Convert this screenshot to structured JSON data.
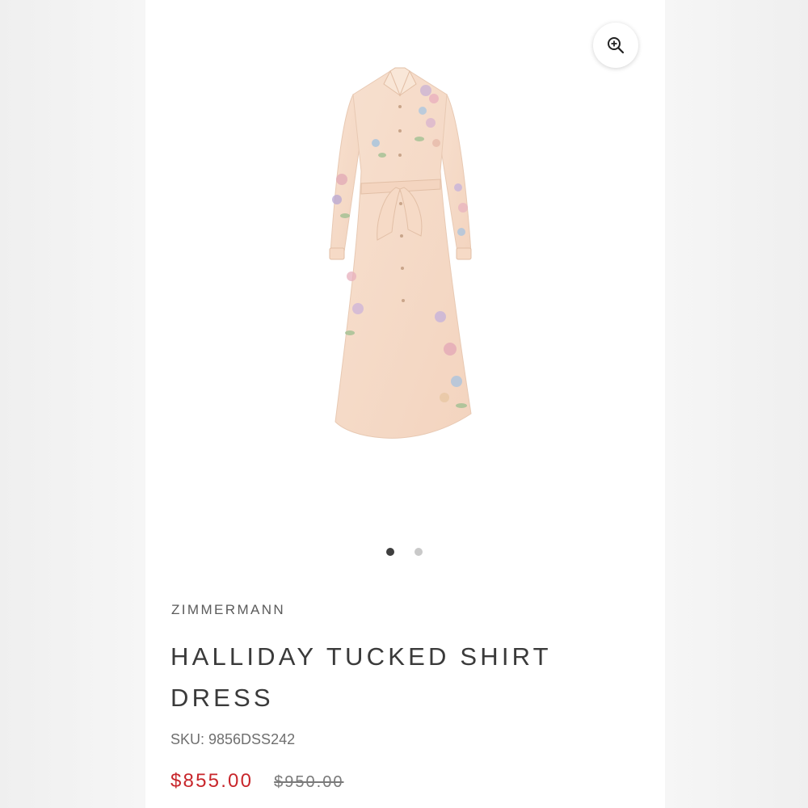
{
  "product": {
    "brand": "ZIMMERMANN",
    "title": "HALLIDAY TUCKED SHIRT DRESS",
    "sku": "SKU: 9856DSS242",
    "sale_price": "$855.00",
    "original_price": "$950.00"
  },
  "gallery": {
    "slide_count": 2,
    "active_slide": 1
  },
  "colors": {
    "sale_price": "#c8262b",
    "dress_base": "#f6dcc8",
    "active_dot": "#3f3f3f",
    "inactive_dot": "#c9c9c9"
  },
  "icons": {
    "zoom": "zoom-in-icon"
  }
}
